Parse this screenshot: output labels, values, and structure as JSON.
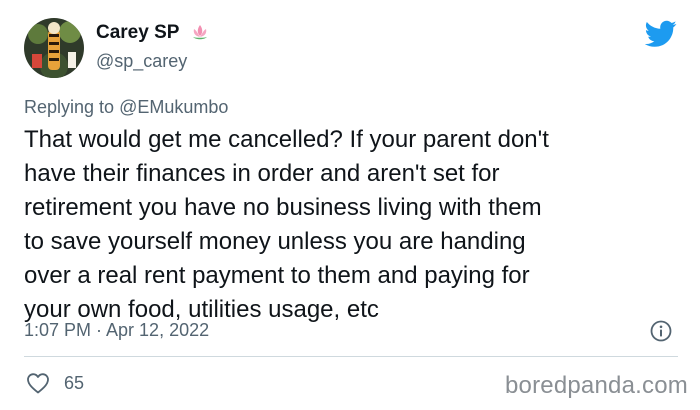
{
  "author": {
    "display_name": "Carey SP",
    "handle": "@sp_carey",
    "name_emoji": "lotus-icon"
  },
  "reply": {
    "prefix": "Replying to",
    "mention": "@EMukumbo"
  },
  "tweet": {
    "lines": [
      "That would get me cancelled?  If your parent don't",
      "have their finances in order and aren't set for",
      "retirement you have no business living with them",
      "to save yourself money unless you are handing",
      "over a real rent payment to them and paying for",
      "your own food, utilities usage, etc"
    ],
    "timestamp": "1:07 PM · Apr 12, 2022"
  },
  "engagement": {
    "likes": "65"
  },
  "watermark": "boredpanda.com",
  "colors": {
    "twitter_blue": "#1d9bf0",
    "secondary_text": "#536471",
    "primary_text": "#0f1419",
    "divider": "#cfd9de"
  }
}
